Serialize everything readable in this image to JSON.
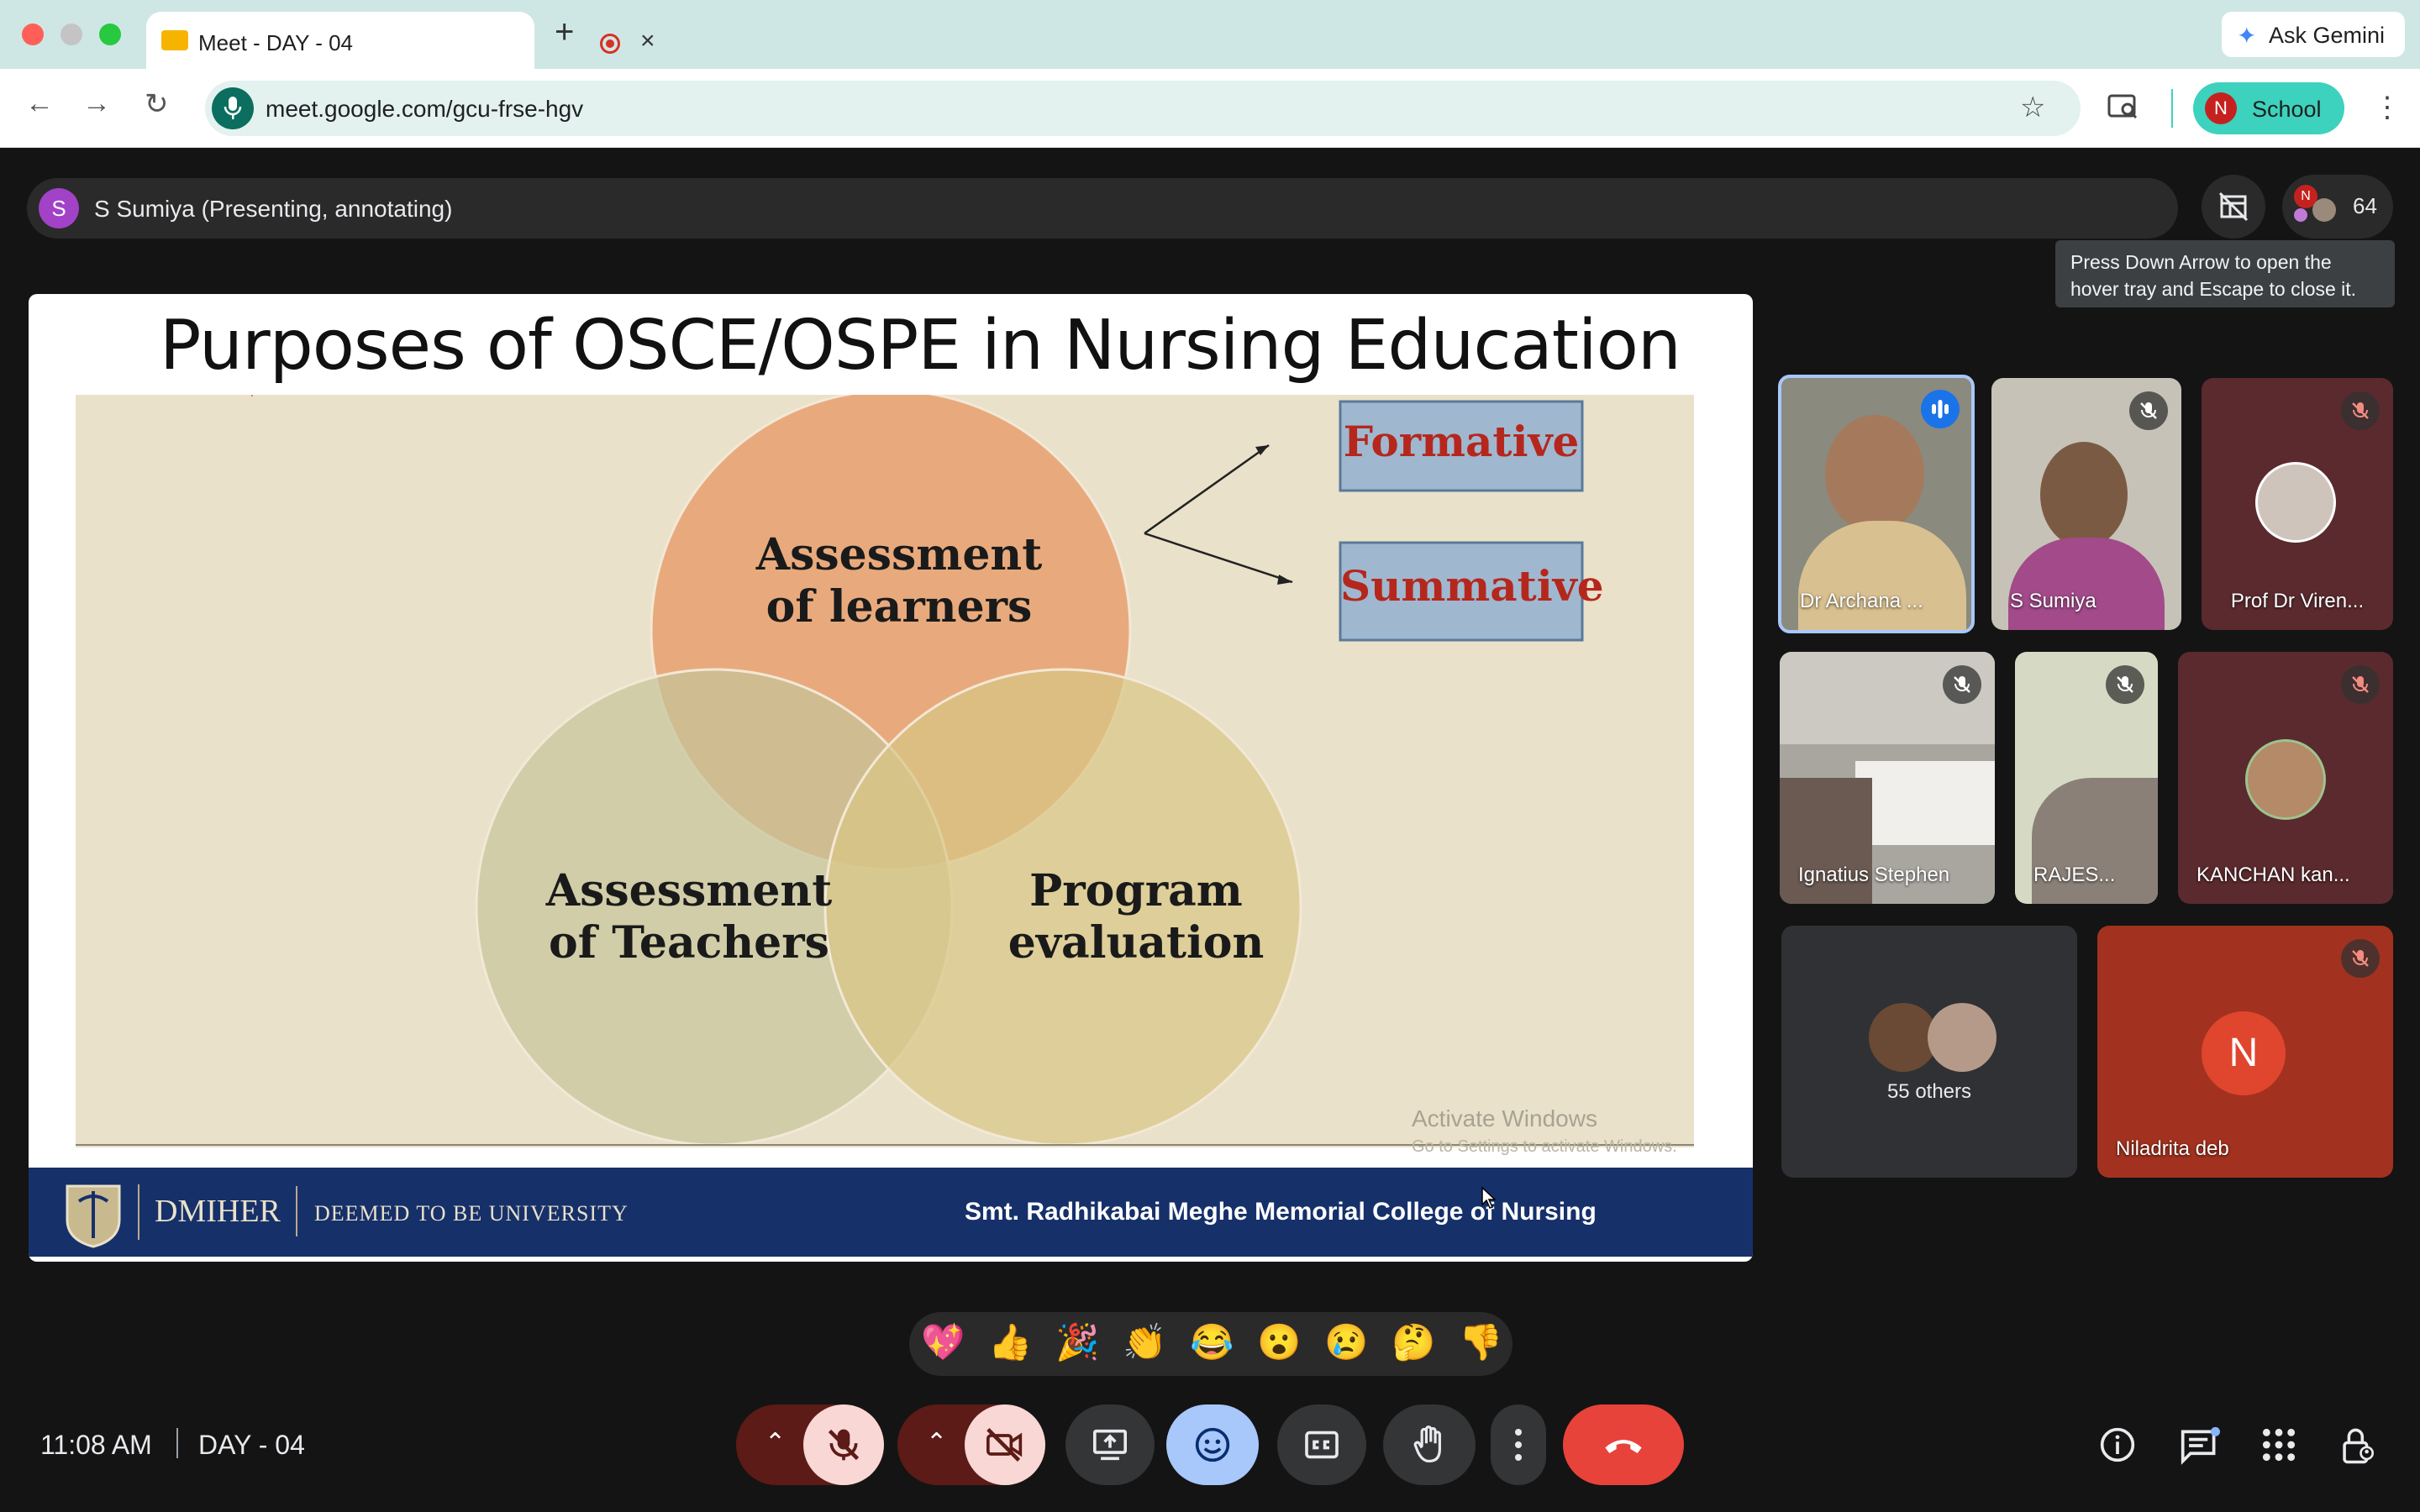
{
  "browser": {
    "tab_title": "Meet - DAY - 04",
    "close_glyph": "×",
    "new_tab_glyph": "+",
    "url": "meet.google.com/gcu-frse-hgv",
    "ask_gemini_label": "Ask Gemini",
    "profile_initial": "N",
    "profile_label": "School"
  },
  "meet": {
    "presenter_initial": "S",
    "presenter_label": "S Sumiya (Presenting, annotating)",
    "participant_count": "64",
    "tooltip_line1": "Press Down Arrow to open the",
    "tooltip_line2": "hover tray and Escape to close it."
  },
  "slide": {
    "title": "Purposes of OSCE/OSPE in Nursing Education",
    "circle_top_line1": "Assessment",
    "circle_top_line2": "of  learners",
    "circle_left_line1": "Assessment",
    "circle_left_line2": "of  Teachers",
    "circle_right_line1": "Program",
    "circle_right_line2": "evaluation",
    "box1": "Formative",
    "box2": "Summative",
    "watermark_line1": "Activate Windows",
    "watermark_line2": "Go to Settings to activate Windows.",
    "footer_brand": "DMIHER",
    "footer_tag": "DEEMED TO BE UNIVERSITY",
    "footer_college": "Smt. Radhikabai Meghe Memorial College of Nursing"
  },
  "participants": {
    "tile1": "Dr Archana ...",
    "tile2": "S Sumiya",
    "tile3": "Prof Dr Viren...",
    "tile4": "Ignatius Stephen",
    "tile5": "RAJES...",
    "tile6": "KANCHAN kan...",
    "others_label": "55 others",
    "tile8_initial": "N",
    "tile8": "Niladrita deb"
  },
  "reactions": [
    "💖",
    "👍",
    "🎉",
    "👏",
    "😂",
    "😮",
    "😢",
    "🤔",
    "👎"
  ],
  "bottom": {
    "time": "11:08 AM",
    "meeting_name": "DAY - 04"
  },
  "colors": {
    "accent_teal": "#3dd2bd",
    "end_call_red": "#e8433b",
    "muted_red": "#f8d7d5",
    "reactions_active": "#a8c7fa"
  }
}
